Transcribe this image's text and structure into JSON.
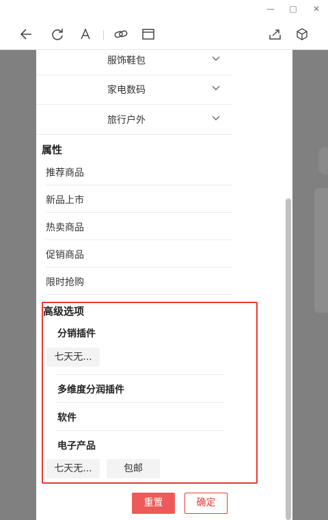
{
  "window": {
    "minimize_glyph": "—",
    "maximize_glyph": "□",
    "close_glyph": "✕"
  },
  "toolbar": {
    "icons": [
      "back-icon",
      "refresh-icon",
      "font-icon",
      "link-icon",
      "window-icon",
      "share-icon",
      "cube-icon"
    ]
  },
  "categories": [
    {
      "label": "服饰鞋包"
    },
    {
      "label": "家电数码"
    },
    {
      "label": "旅行户外"
    }
  ],
  "attributes": {
    "title": "属性",
    "items": [
      "推荐商品",
      "新品上市",
      "热卖商品",
      "促销商品",
      "限时抢购"
    ]
  },
  "advanced": {
    "title": "高级选项",
    "plugins": [
      {
        "name": "分销插件",
        "tags": [
          "七天无..."
        ]
      },
      {
        "name": "多维度分润插件",
        "tags": []
      },
      {
        "name": "软件",
        "tags": []
      },
      {
        "name": "电子产品",
        "tags": [
          "七天无...",
          "包邮"
        ]
      }
    ]
  },
  "actions": {
    "reset_label": "重置",
    "confirm_label": "确定"
  },
  "colors": {
    "accent": "#e53935",
    "reset_bg": "#ee5a5a",
    "backdrop": "#808080"
  }
}
